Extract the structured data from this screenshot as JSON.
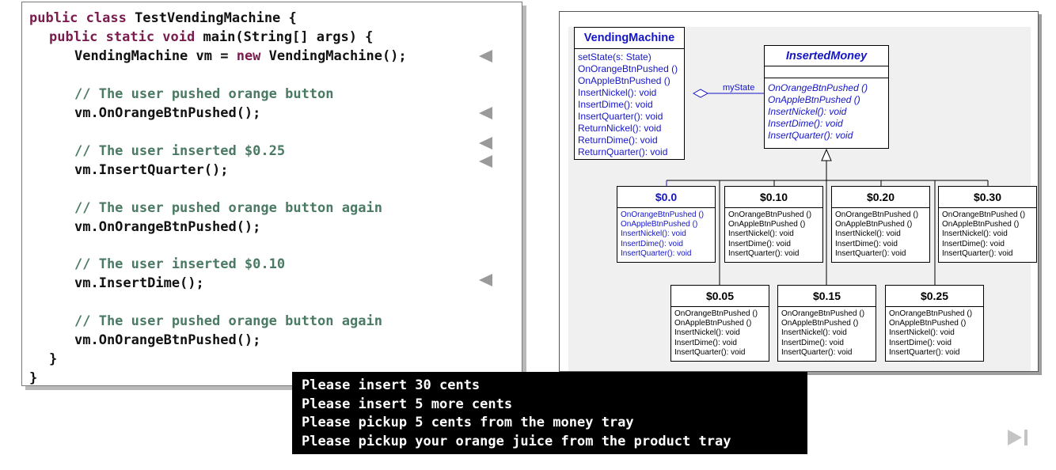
{
  "code": {
    "l1": {
      "kw": "public class",
      "rest": " TestVendingMachine {"
    },
    "l2": {
      "kw": "public static void",
      "rest": " main(String[] args) {"
    },
    "l3": {
      "pre": "VendingMachine vm = ",
      "kw": "new",
      "post": " VendingMachine();"
    },
    "c1": "// The user pushed orange button",
    "s1": "vm.OnOrangeBtnPushed();",
    "c2": "// The user inserted $0.25",
    "s2": "vm.InsertQuarter();",
    "c3": "// The user pushed orange button again",
    "s3": "vm.OnOrangeBtnPushed();",
    "c4": "// The user inserted $0.10",
    "s4": "vm.InsertDime();",
    "c5": "// The user pushed orange button again",
    "s5": "vm.OnOrangeBtnPushed();",
    "close1": "}",
    "close2": "}"
  },
  "console": {
    "lines": [
      "Please insert 30 cents",
      "Please insert 5 more cents",
      "Please pickup 5 cents from the money tray",
      "Please pickup your orange juice from the product tray"
    ]
  },
  "uml": {
    "vending_machine": {
      "name": "VendingMachine",
      "ops": [
        "setState(s: State)",
        "OnOrangeBtnPushed ()",
        "OnAppleBtnPushed ()",
        "InsertNickel(): void",
        "InsertDime(): void",
        "InsertQuarter(): void",
        "ReturnNickel(): void",
        "ReturnDime(): void",
        "ReturnQuarter(): void"
      ]
    },
    "inserted_money": {
      "name": "InsertedMoney",
      "ops": [
        "OnOrangeBtnPushed ()",
        "OnAppleBtnPushed ()",
        "InsertNickel(): void",
        "InsertDime(): void",
        "InsertQuarter(): void"
      ]
    },
    "association_label": "myState",
    "states": [
      {
        "name": "$0.0",
        "ops": [
          "OnOrangeBtnPushed ()",
          "OnAppleBtnPushed ()",
          "InsertNickel(): void",
          "InsertDime(): void",
          "InsertQuarter(): void"
        ]
      },
      {
        "name": "$0.10",
        "ops": [
          "OnOrangeBtnPushed ()",
          "OnAppleBtnPushed ()",
          "InsertNickel(): void",
          "InsertDime(): void",
          "InsertQuarter(): void"
        ]
      },
      {
        "name": "$0.20",
        "ops": [
          "OnOrangeBtnPushed ()",
          "OnAppleBtnPushed ()",
          "InsertNickel(): void",
          "InsertDime(): void",
          "InsertQuarter(): void"
        ]
      },
      {
        "name": "$0.30",
        "ops": [
          "OnOrangeBtnPushed ()",
          "OnAppleBtnPushed ()",
          "InsertNickel(): void",
          "InsertDime(): void",
          "InsertQuarter(): void"
        ]
      },
      {
        "name": "$0.05",
        "ops": [
          "OnOrangeBtnPushed ()",
          "OnAppleBtnPushed ()",
          "InsertNickel(): void",
          "InsertDime(): void",
          "InsertQuarter(): void"
        ]
      },
      {
        "name": "$0.15",
        "ops": [
          "OnOrangeBtnPushed ()",
          "OnAppleBtnPushed ()",
          "InsertNickel(): void",
          "InsertDime(): void",
          "InsertQuarter(): void"
        ]
      },
      {
        "name": "$0.25",
        "ops": [
          "OnOrangeBtnPushed ()",
          "OnAppleBtnPushed ()",
          "InsertNickel(): void",
          "InsertDime(): void",
          "InsertQuarter(): void"
        ]
      }
    ]
  },
  "colors": {
    "keyword": "#7a1c4e",
    "comment": "#4a7a63",
    "uml_blue": "#1515c8"
  },
  "nav": {
    "icon": "skip-to-end-icon"
  }
}
